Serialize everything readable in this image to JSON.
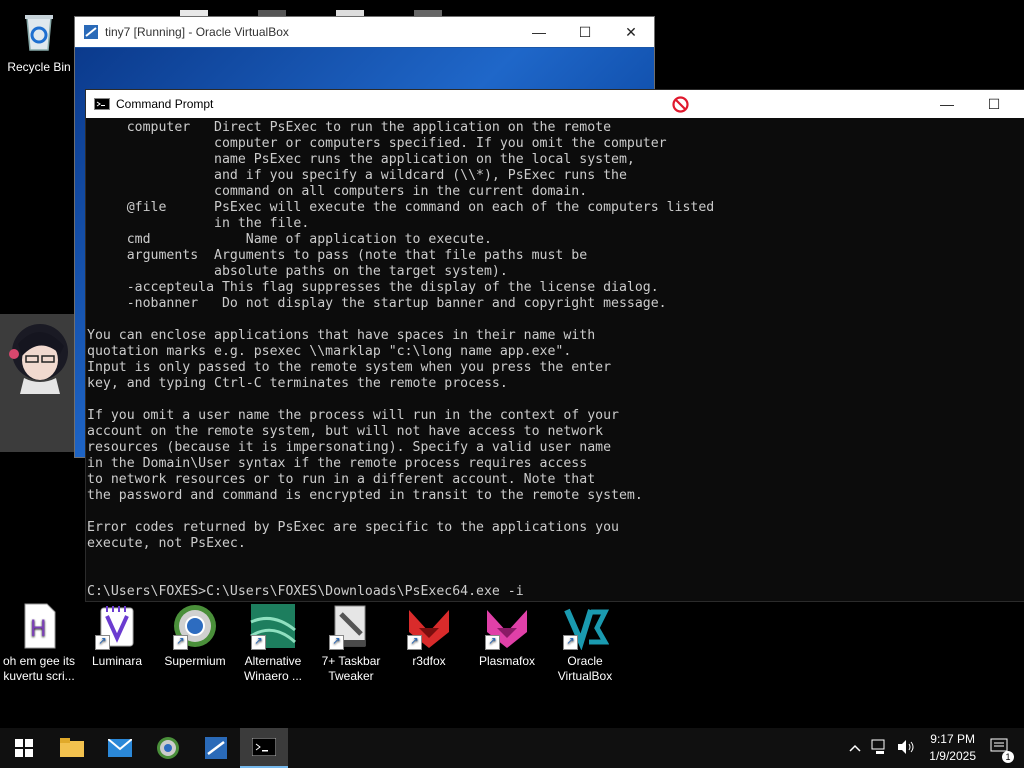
{
  "desktop": {
    "recycle_bin": "Recycle Bin",
    "icons": [
      {
        "label1": "oh em gee its",
        "label2": "kuvertu scri..."
      },
      {
        "label1": "Luminara",
        "label2": ""
      },
      {
        "label1": "Supermium",
        "label2": ""
      },
      {
        "label1": "Alternative",
        "label2": "Winaero ..."
      },
      {
        "label1": "7+ Taskbar",
        "label2": "Tweaker"
      },
      {
        "label1": "r3dfox",
        "label2": ""
      },
      {
        "label1": "Plasmafox",
        "label2": ""
      },
      {
        "label1": "Oracle",
        "label2": "VirtualBox"
      }
    ]
  },
  "vbox_window": {
    "title": "tiny7 [Running] - Oracle VirtualBox",
    "minimize": "—",
    "maximize": "☐",
    "close": "✕"
  },
  "cmd_window": {
    "title": "Command Prompt",
    "minimize": "—",
    "maximize": "☐",
    "output": "     computer   Direct PsExec to run the application on the remote\n                computer or computers specified. If you omit the computer\n                name PsExec runs the application on the local system,\n                and if you specify a wildcard (\\\\*), PsExec runs the\n                command on all computers in the current domain.\n     @file      PsExec will execute the command on each of the computers listed\n                in the file.\n     cmd            Name of application to execute.\n     arguments  Arguments to pass (note that file paths must be\n                absolute paths on the target system).\n     -accepteula This flag suppresses the display of the license dialog.\n     -nobanner   Do not display the startup banner and copyright message.\n\nYou can enclose applications that have spaces in their name with\nquotation marks e.g. psexec \\\\marklap \"c:\\long name app.exe\".\nInput is only passed to the remote system when you press the enter\nkey, and typing Ctrl-C terminates the remote process.\n\nIf you omit a user name the process will run in the context of your\naccount on the remote system, but will not have access to network\nresources (because it is impersonating). Specify a valid user name\nin the Domain\\User syntax if the remote process requires access\nto network resources or to run in a different account. Note that\nthe password and command is encrypted in transit to the remote system.\n\nError codes returned by PsExec are specific to the applications you\nexecute, not PsExec.\n\n\nC:\\Users\\FOXES>C:\\Users\\FOXES\\Downloads\\PsExec64.exe -i"
  },
  "taskbar": {
    "time": "9:17 PM",
    "date": "1/9/2025",
    "notification_count": "1"
  },
  "colors": {
    "taskbar": "#101010",
    "console_bg": "#0c0c0c",
    "console_text": "#cccccc",
    "vbox_blue": "#1b57a8"
  }
}
